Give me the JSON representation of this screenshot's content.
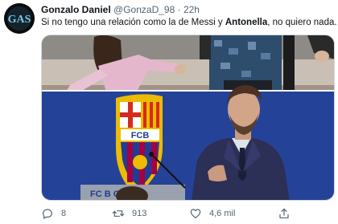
{
  "tweet": {
    "author": {
      "display_name": "Gonzalo Daniel",
      "handle": "@GonzaD_98",
      "avatar_text": "GAS"
    },
    "separator": "·",
    "time": "22h",
    "text_before": "Si no tengo una relación como la de Messi y ",
    "text_bold": "Antonella",
    "text_after": ", no quiero nada.",
    "media": {
      "crest_initials": "FCB",
      "backdrop_text": "FC B     ONA"
    },
    "stats": {
      "replies": "8",
      "retweets": "913",
      "likes": "4,6 mil"
    }
  },
  "colors": {
    "muted": "#536471",
    "barca_blue": "#1f3d95",
    "barca_red": "#a50044",
    "gold": "#edbb00"
  },
  "icons": {
    "reply": "reply-icon",
    "retweet": "retweet-icon",
    "like": "heart-icon",
    "share": "share-icon"
  }
}
